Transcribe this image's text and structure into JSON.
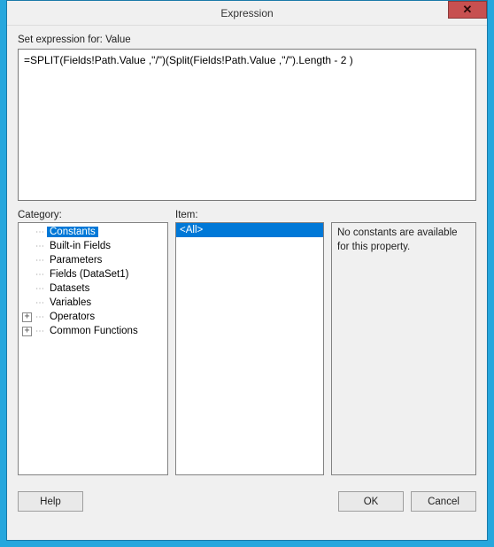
{
  "window": {
    "title": "Expression",
    "close_glyph": "✕"
  },
  "labels": {
    "set_expression": "Set expression for: Value",
    "category": "Category:",
    "item": "Item:"
  },
  "expression": {
    "value": "=SPLIT(Fields!Path.Value ,\"/\")(Split(Fields!Path.Value ,\"/\").Length - 2 )"
  },
  "category_tree": [
    {
      "label": "Constants",
      "selected": true,
      "expandable": false
    },
    {
      "label": "Built-in Fields",
      "selected": false,
      "expandable": false
    },
    {
      "label": "Parameters",
      "selected": false,
      "expandable": false
    },
    {
      "label": "Fields (DataSet1)",
      "selected": false,
      "expandable": false
    },
    {
      "label": "Datasets",
      "selected": false,
      "expandable": false
    },
    {
      "label": "Variables",
      "selected": false,
      "expandable": false
    },
    {
      "label": "Operators",
      "selected": false,
      "expandable": true
    },
    {
      "label": "Common Functions",
      "selected": false,
      "expandable": true
    }
  ],
  "items": [
    {
      "label": "<All>",
      "selected": true
    }
  ],
  "description": "No constants are available for this property.",
  "buttons": {
    "help": "Help",
    "ok": "OK",
    "cancel": "Cancel"
  }
}
